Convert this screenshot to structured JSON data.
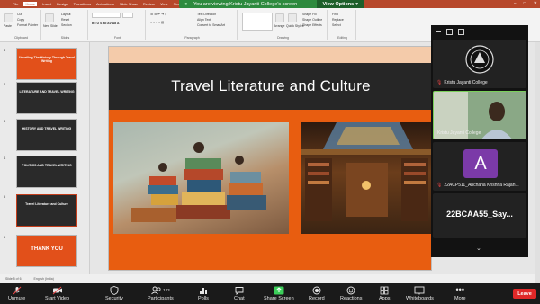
{
  "banner": {
    "share_text": "You are viewing Kristu Jayanti College's screen",
    "view_options": "View Options"
  },
  "ppt": {
    "tabs": [
      "File",
      "Home",
      "Insert",
      "Design",
      "Transitions",
      "Animations",
      "Slide Show",
      "Review",
      "View",
      "Storyboarding",
      "Tell me what you want to do"
    ],
    "ribbon": {
      "clipboard_label": "Clipboard",
      "paste": "Paste",
      "cut": "Cut",
      "copy": "Copy",
      "format_painter": "Format Painter",
      "slides_label": "Slides",
      "new_slide": "New Slide",
      "layout": "Layout",
      "reset": "Reset",
      "section": "Section",
      "font_label": "Font",
      "paragraph_label": "Paragraph",
      "text_direction": "Text Direction",
      "align_text": "Align Text",
      "convert_smartart": "Convert to SmartArt",
      "drawing_label": "Drawing",
      "arrange": "Arrange",
      "quick_styles": "Quick Styles",
      "shape_fill": "Shape Fill",
      "shape_outline": "Shape Outline",
      "shape_effects": "Shape Effects",
      "editing_label": "Editing",
      "find": "Find",
      "replace": "Replace",
      "select": "Select"
    },
    "thumbnails": [
      {
        "num": "1",
        "title": "Unveiling The History Through Travel Writing",
        "color": "#e2501a"
      },
      {
        "num": "2",
        "title": "LITERATURE AND TRAVEL WRITING",
        "color": "#2a2a2a"
      },
      {
        "num": "3",
        "title": "HISTORY AND TRAVEL WRITING",
        "color": "#2a2a2a"
      },
      {
        "num": "4",
        "title": "POLITICS AND TRAVEL WRITING",
        "color": "#2a2a2a"
      },
      {
        "num": "5",
        "title": "Travel Literature and Culture",
        "color": "#2a2a2a"
      },
      {
        "num": "6",
        "title": "THANK YOU",
        "color": "#e2501a"
      }
    ],
    "slide": {
      "title": "Travel Literature and Culture"
    },
    "status": {
      "slide_count": "Slide 5 of 6",
      "language": "English (India)"
    }
  },
  "gallery": {
    "participants": [
      {
        "name": "Kristu Jayanti College",
        "type": "logo",
        "muted": true
      },
      {
        "name": "Kristu Jayanti College",
        "type": "video",
        "muted": false,
        "active": true
      },
      {
        "name": "22ACP511_Anchana Krishna Rajan...",
        "type": "avatar",
        "initial": "A",
        "muted": true
      },
      {
        "name": "22BCAA55_Say...",
        "type": "name-only",
        "muted": false
      }
    ]
  },
  "toolbar": {
    "unmute": "Unmute",
    "start_video": "Start Video",
    "security": "Security",
    "participants": "Participants",
    "participants_count": "123",
    "polls": "Polls",
    "chat": "Chat",
    "share_screen": "Share Screen",
    "record": "Record",
    "reactions": "Reactions",
    "apps": "Apps",
    "whiteboards": "Whiteboards",
    "more": "More",
    "leave": "Leave"
  }
}
